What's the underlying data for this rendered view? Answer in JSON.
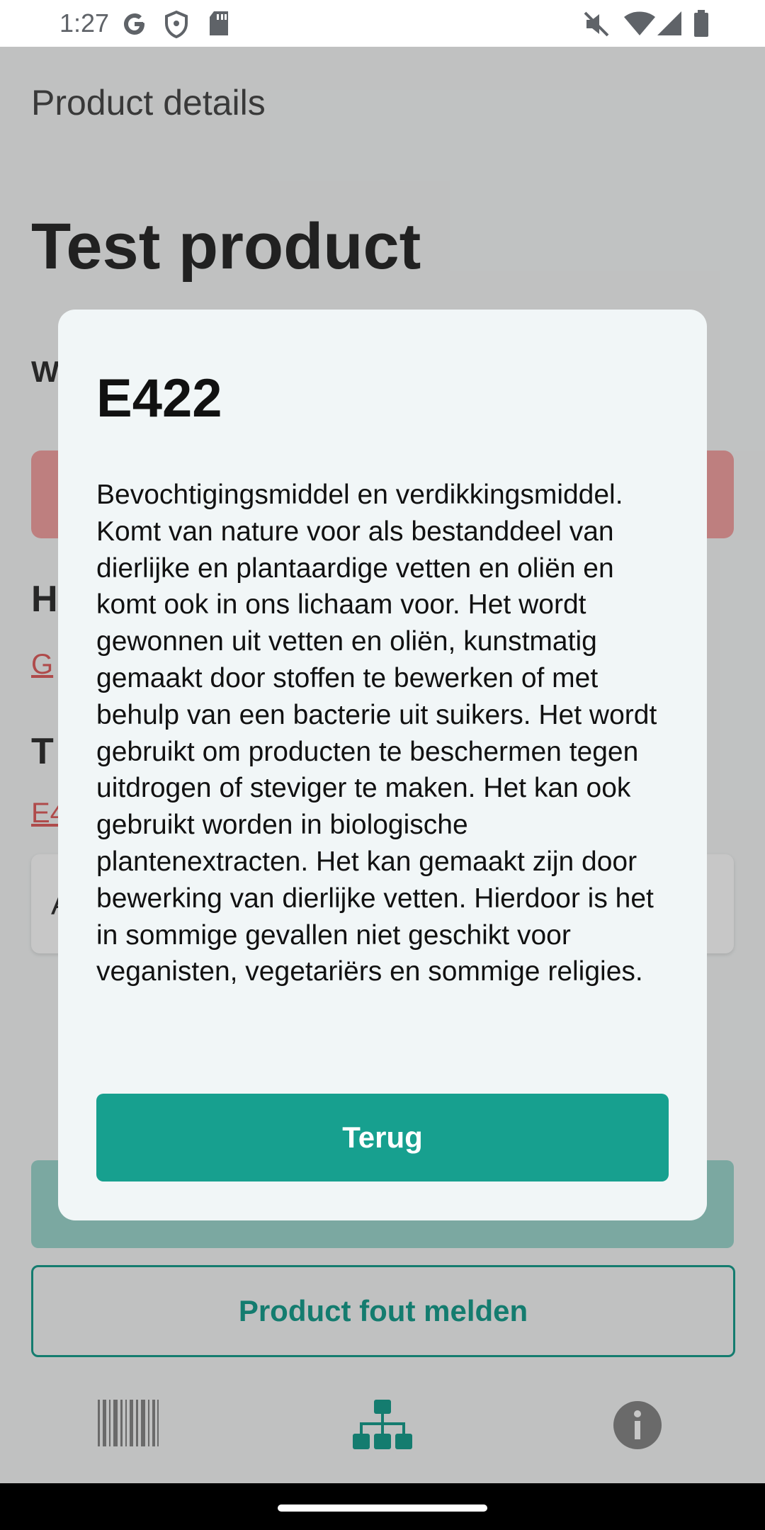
{
  "status_bar": {
    "time": "1:27",
    "left_icons": [
      "google-icon",
      "shield-icon",
      "sd-card-icon"
    ],
    "right_icons": [
      "mute-icon",
      "wifi-icon",
      "signal-icon",
      "battery-icon"
    ]
  },
  "background_screen": {
    "title": "Product details",
    "product_name": "Test product",
    "section_w": "W",
    "section_h": "H",
    "link_g": "G",
    "section_t": "T",
    "link_e4": "E4",
    "card_letter": "A",
    "report_button": "Product fout melden",
    "bottom_nav": [
      "barcode-icon",
      "sitemap-icon",
      "info-icon"
    ]
  },
  "dialog": {
    "title": "E422",
    "body": "Bevochtigingsmiddel en verdikkingsmiddel. Komt van nature voor als bestanddeel van dierlijke en plantaardige vetten en oliën en komt ook in ons lichaam voor. Het wordt gewonnen uit vetten en oliën, kunstmatig gemaakt door stoffen te bewerken of met behulp van een bacterie uit suikers. Het wordt gebruikt om producten te beschermen tegen uitdrogen of steviger te maken. Het kan ook gebruikt worden in biologische plantenextracten. Het kan gemaakt zijn door bewerking van dierlijke vetten. Hierdoor is het in sommige gevallen niet geschikt voor veganisten, vegetariërs en sommige religies.",
    "button_label": "Terug"
  },
  "colors": {
    "accent": "#17a08f",
    "dialog_bg": "#f1f6f7",
    "scrim": "rgba(0,0,0,0.22)"
  }
}
